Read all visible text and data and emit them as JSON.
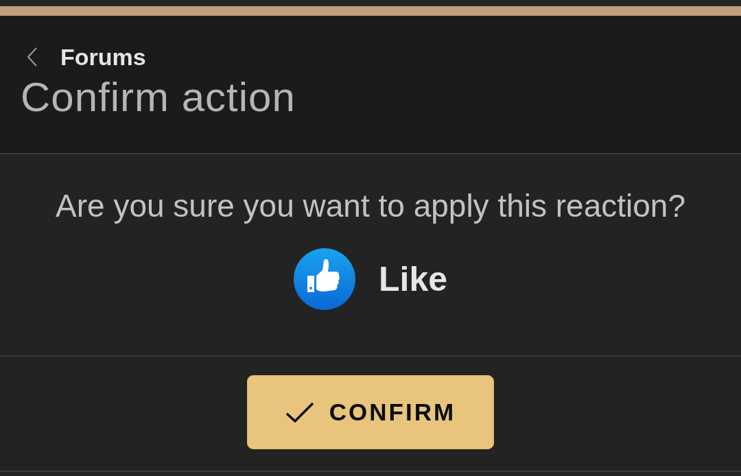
{
  "header": {
    "breadcrumb": "Forums",
    "title": "Confirm action"
  },
  "dialog": {
    "question": "Are you sure you want to apply this reaction?",
    "reaction": {
      "label": "Like"
    }
  },
  "confirm_button": {
    "label": "CONFIRM"
  }
}
